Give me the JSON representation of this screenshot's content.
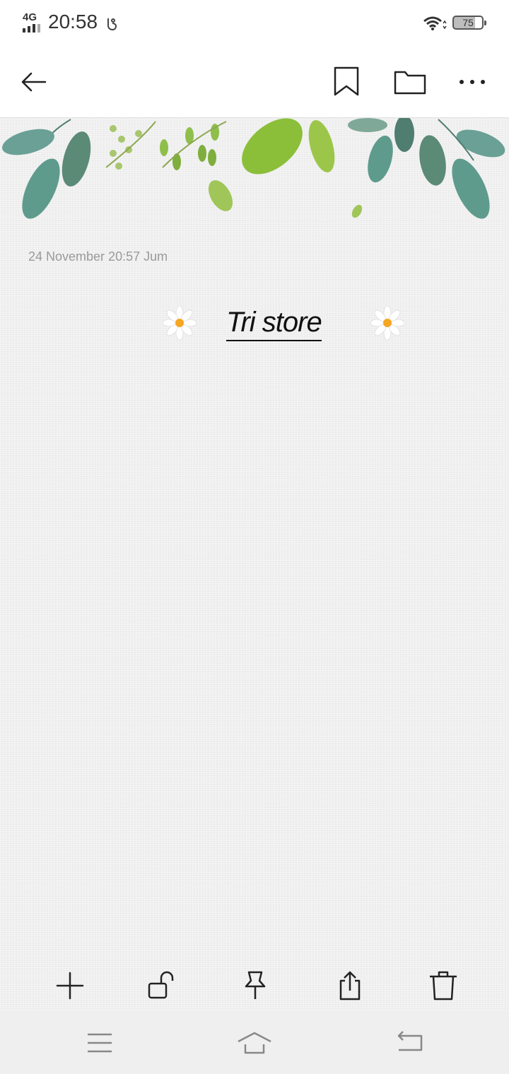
{
  "status_bar": {
    "network": "4G",
    "time": "20:58",
    "battery": "75"
  },
  "note": {
    "date": "24 November  20:57 Jum",
    "title": "Tri store"
  },
  "icons": {
    "back": "arrow-left-icon",
    "bookmark": "bookmark-icon",
    "folder": "folder-icon",
    "more": "more-icon",
    "add": "plus-icon",
    "lock": "unlock-icon",
    "pin": "pin-icon",
    "share": "share-icon",
    "delete": "trash-icon"
  },
  "colors": {
    "leaf_green": "#8bbf3a",
    "leaf_teal": "#5d9387",
    "daisy_center": "#f5a623"
  }
}
